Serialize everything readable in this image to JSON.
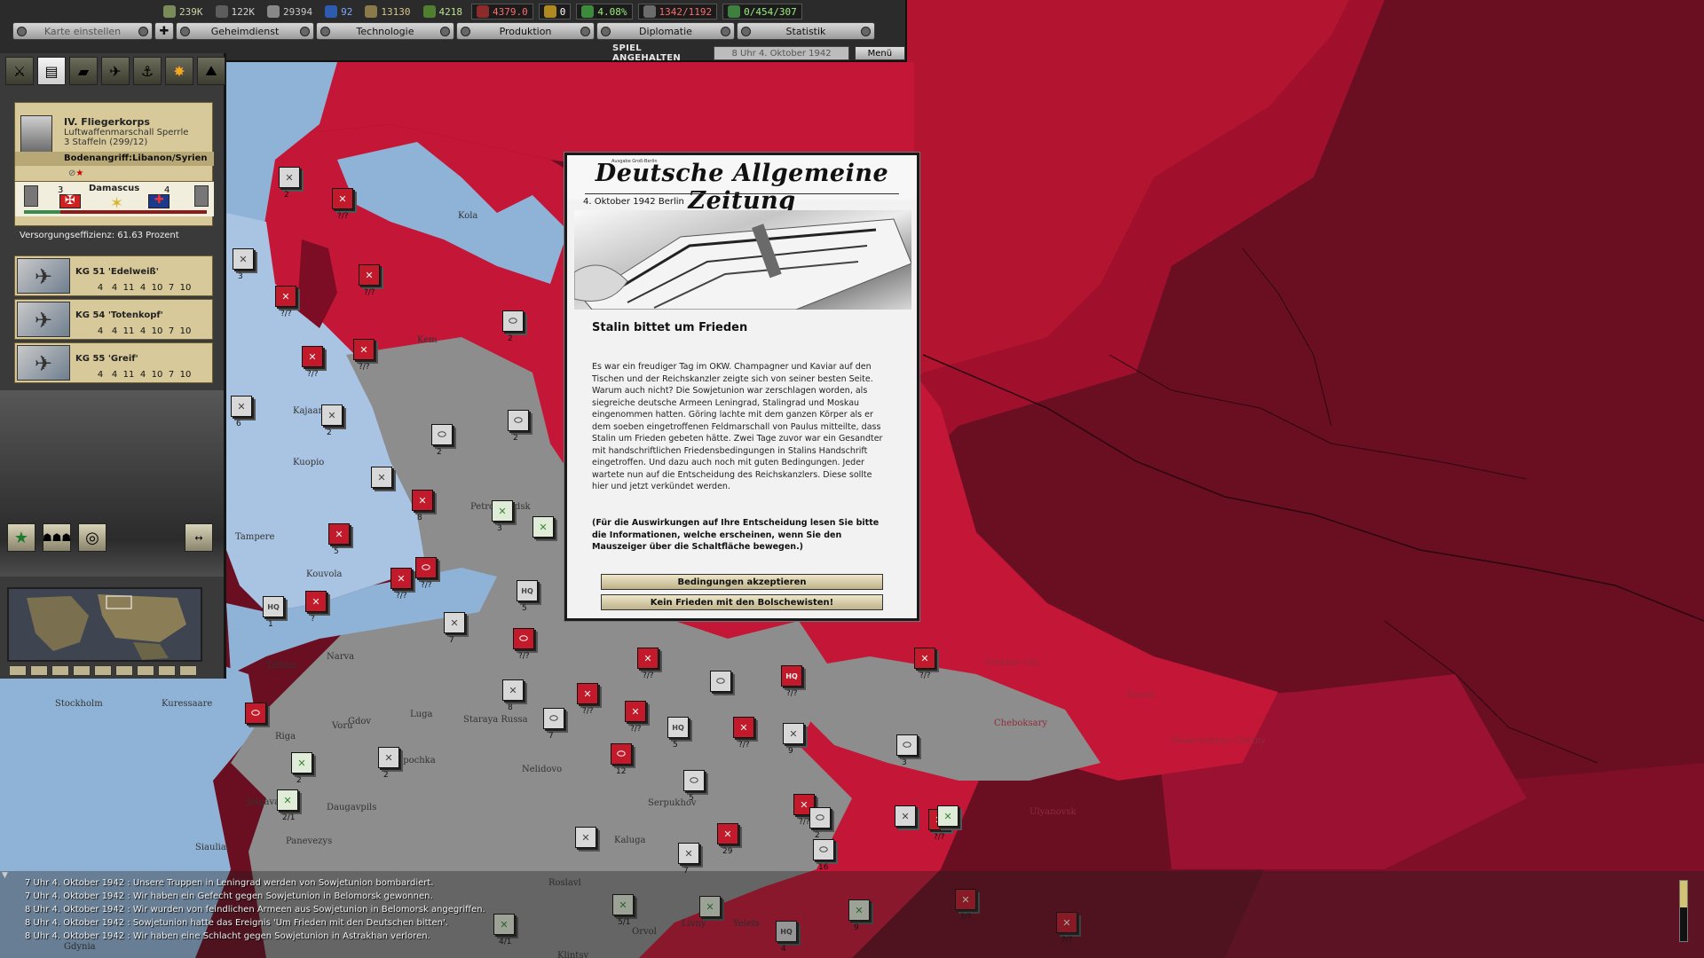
{
  "colors": {
    "sea": "#8fb3d6",
    "finland": "#a9c4e2",
    "soviet": "#c41636",
    "soviet_dark": "#9c0f2a",
    "soviet_deep": "#6a0f22",
    "axis_grey": "#8d8d8d",
    "panel": "#3a3a3a",
    "card": "#d7c99a"
  },
  "resources": [
    {
      "icon": "manpower-icon",
      "value": "239K",
      "color": "#c8d2a0"
    },
    {
      "icon": "energy-icon",
      "value": "122K",
      "color": "#d0d0d0"
    },
    {
      "icon": "metal-icon",
      "value": "29394",
      "color": "#c8c8c8"
    },
    {
      "icon": "oil-icon",
      "value": "92",
      "color": "#7fa7ff"
    },
    {
      "icon": "supplies-icon",
      "value": "13130",
      "color": "#d6c48a"
    },
    {
      "icon": "money-icon",
      "value": "4218",
      "color": "#b9e08c"
    },
    {
      "icon": "ic-icon",
      "value": "4379.0",
      "color": "#ff6a6a"
    },
    {
      "icon": "leadership-icon",
      "value": "0",
      "color": "#ffffff"
    },
    {
      "icon": "dissent-icon",
      "value": "4.08%",
      "color": "#9cf07a"
    },
    {
      "icon": "convoy-icon",
      "value": "1342/1192",
      "color": "#ff6a6a"
    },
    {
      "icon": "transport-icon",
      "value": "0/454/307",
      "color": "#9cf07a"
    }
  ],
  "menu": {
    "mapmode": "Karte einstellen",
    "buttons": [
      "Geheimdienst",
      "Technologie",
      "Produktion",
      "Diplomatie",
      "Statistik"
    ],
    "paused": "SPIEL ANGEHALTEN",
    "date": "8 Uhr 4. Oktober 1942",
    "menu_label": "Menü"
  },
  "corps": {
    "name": "IV. Fliegerkorps",
    "commander": "Luftwaffenmarschall Sperrle",
    "strength": "3 Staffeln (299/12)",
    "mission": "Bodenangriff:Libanon/Syrien",
    "battle_location": "Damascus",
    "attacker_count": "3",
    "defender_count": "4",
    "battle_progress": 0.2
  },
  "supply": "Versorgungseffizienz: 61.63 Prozent",
  "units": [
    {
      "name": "KG 51 'Edelweiß'",
      "stats": [
        "4",
        "4",
        "11",
        "4",
        "10",
        "7",
        "10"
      ]
    },
    {
      "name": "KG 54 'Totenkopf'",
      "stats": [
        "4",
        "4",
        "11",
        "4",
        "10",
        "7",
        "10"
      ]
    },
    {
      "name": "KG 55 'Greif'",
      "stats": [
        "4",
        "4",
        "11",
        "4",
        "10",
        "7",
        "10"
      ]
    }
  ],
  "newspaper": {
    "masthead": "Deutsche Allgemeine Zeitung",
    "masthead_small": "Ausgabe Groß-Berlin",
    "date": "4. Oktober 1942 Berlin",
    "headline": "Stalin bittet um Frieden",
    "body": "Es war ein freudiger Tag im OKW. Champagner und Kaviar auf den Tischen und der Reichskanzler zeigte sich von seiner besten Seite. Warum auch nicht? Die Sowjetunion war zerschlagen worden, als siegreiche deutsche Armeen Leningrad, Stalingrad und Moskau eingenommen hatten. Göring lachte mit dem ganzen Körper als er dem soeben eingetroffenen Feldmarschall von Paulus mitteilte, dass Stalin um Frieden gebeten hätte. Zwei Tage zuvor war ein Gesandter mit handschriftlichen Friedensbedingungen in Stalins Handschrift eingetroffen. Und dazu auch noch mit guten Bedingungen. Jeder wartete nun auf die Entscheidung des Reichskanzlers. Diese sollte hier und jetzt verkündet werden.",
    "note": "(Für die Auswirkungen auf Ihre Entscheidung lesen Sie bitte die Informationen, welche erscheinen, wenn Sie den Mauszeiger über die Schaltfläche bewegen.)",
    "accept": "Bedingungen akzeptieren",
    "reject": "Kein Frieden mit den Bolschewisten!"
  },
  "map_labels": [
    {
      "text": "Kola"
    },
    {
      "text": "Kem"
    },
    {
      "text": "Kuopio"
    },
    {
      "text": "Tampere"
    },
    {
      "text": "Kouvola"
    },
    {
      "text": "Narva"
    },
    {
      "text": "Tallinn"
    },
    {
      "text": "Gdov"
    },
    {
      "text": "Luga"
    },
    {
      "text": "Staraya Russa"
    },
    {
      "text": "Voru"
    },
    {
      "text": "Riga"
    },
    {
      "text": "Jelgava"
    },
    {
      "text": "Daugavpils"
    },
    {
      "text": "Opochka"
    },
    {
      "text": "Nelidovo"
    },
    {
      "text": "Kaluga"
    },
    {
      "text": "Serpukhov"
    },
    {
      "text": "Siauliai"
    },
    {
      "text": "Panevezys"
    },
    {
      "text": "Stockholm"
    },
    {
      "text": "Kuressaare"
    },
    {
      "text": "Kazan"
    },
    {
      "text": "Yoshkar Ola"
    },
    {
      "text": "Cheboksary"
    },
    {
      "text": "Naberezhnye Chelny"
    },
    {
      "text": "Ulyanovsk"
    },
    {
      "text": "Orvol"
    },
    {
      "text": "Livny"
    },
    {
      "text": "Yelets"
    },
    {
      "text": "Roslavl"
    },
    {
      "text": "Klintsy"
    },
    {
      "text": "Gdynia"
    },
    {
      "text": "Kajaani"
    },
    {
      "text": "Petrozavodsk"
    }
  ],
  "log": [
    "7 Uhr 4. Oktober 1942 : Unsere Truppen in Leningrad werden von Sowjetunion bombardiert.",
    "7 Uhr 4. Oktober 1942 : Wir haben ein Gefecht gegen Sowjetunion in Belomorsk gewonnen.",
    "8 Uhr 4. Oktober 1942 : Wir wurden von feindlichen Armeen aus Sowjetunion in Belomorsk angegriffen.",
    "8 Uhr 4. Oktober 1942 : Sowjetunion hatte das Ereignis 'Um Frieden mit den Deutschen bitten'.",
    "8 Uhr 4. Oktober 1942 : Wir haben eine Schlacht gegen Sowjetunion in Astrakhan verloren."
  ],
  "counters": [
    {
      "label": "2",
      "type": "inf",
      "side": "ger"
    },
    {
      "label": "?/?",
      "type": "inf",
      "side": "sov"
    },
    {
      "label": "3",
      "type": "inf",
      "side": "ger"
    },
    {
      "label": "?/?",
      "type": "inf",
      "side": "sov"
    },
    {
      "label": "2",
      "type": "arm",
      "side": "ger"
    },
    {
      "label": "?/?",
      "type": "inf",
      "side": "sov"
    },
    {
      "label": "?/?",
      "type": "inf",
      "side": "sov"
    },
    {
      "label": "?/?",
      "type": "inf",
      "side": "sov"
    },
    {
      "label": "6",
      "type": "inf",
      "side": "ger"
    },
    {
      "label": "2",
      "type": "inf",
      "side": "ger"
    },
    {
      "label": "2",
      "type": "arm",
      "side": "ger"
    },
    {
      "label": "2",
      "type": "arm",
      "side": "ger"
    },
    {
      "label": "",
      "type": "inf",
      "side": "ger"
    },
    {
      "label": "8",
      "type": "inf",
      "side": "sov"
    },
    {
      "label": "3",
      "type": "inf",
      "side": "ally"
    },
    {
      "label": "5",
      "type": "inf",
      "side": "sov"
    },
    {
      "label": "",
      "type": "inf",
      "side": "ally"
    },
    {
      "label": "?/?",
      "type": "arm",
      "side": "sov"
    },
    {
      "label": "?/?",
      "type": "inf",
      "side": "sov"
    },
    {
      "label": "?",
      "type": "inf",
      "side": "sov"
    },
    {
      "label": "7",
      "type": "inf",
      "side": "ger"
    },
    {
      "label": "5",
      "type": "hq",
      "side": "ger"
    },
    {
      "label": "1",
      "type": "hq",
      "side": "ger"
    },
    {
      "label": "?/?",
      "type": "arm",
      "side": "sov"
    },
    {
      "label": "?/?",
      "type": "inf",
      "side": "sov"
    },
    {
      "label": "?/?",
      "type": "inf",
      "side": "sov"
    },
    {
      "label": "?/?",
      "type": "inf",
      "side": "sov"
    },
    {
      "label": "",
      "type": "arm",
      "side": "ger"
    },
    {
      "label": "8",
      "type": "inf",
      "side": "ger"
    },
    {
      "label": "7",
      "type": "arm",
      "side": "ger"
    },
    {
      "label": "?/?",
      "type": "inf",
      "side": "sov"
    },
    {
      "label": "5",
      "type": "hq",
      "side": "ger"
    },
    {
      "label": "?/?",
      "type": "inf",
      "side": "sov"
    },
    {
      "label": "12",
      "type": "arm",
      "side": "sov"
    },
    {
      "label": "5",
      "type": "arm",
      "side": "ger"
    },
    {
      "label": "",
      "type": "inf",
      "side": "ger"
    },
    {
      "label": "9",
      "type": "inf",
      "side": "ger"
    },
    {
      "label": "?/?",
      "type": "inf",
      "side": "sov"
    },
    {
      "label": "?/?",
      "type": "hq",
      "side": "sov"
    },
    {
      "label": "3",
      "type": "arm",
      "side": "ger"
    },
    {
      "label": "2",
      "type": "arm",
      "side": "ger"
    },
    {
      "label": "?/?",
      "type": "inf",
      "side": "sov"
    },
    {
      "label": "16",
      "type": "arm",
      "side": "ger"
    },
    {
      "label": "29",
      "type": "inf",
      "side": "sov"
    },
    {
      "label": "",
      "type": "inf",
      "side": "ger"
    },
    {
      "label": "7",
      "type": "inf",
      "side": "ger"
    },
    {
      "label": "",
      "type": "arm",
      "side": "sov"
    },
    {
      "label": "2",
      "type": "inf",
      "side": "ally"
    },
    {
      "label": "2",
      "type": "inf",
      "side": "ger"
    },
    {
      "label": "2/1",
      "type": "inf",
      "side": "ally"
    },
    {
      "label": "",
      "type": "inf",
      "side": "ally"
    },
    {
      "label": "?/?",
      "type": "inf",
      "side": "sov"
    },
    {
      "label": "?/?",
      "type": "inf",
      "side": "sov"
    },
    {
      "label": "5/1",
      "type": "inf",
      "side": "ally"
    },
    {
      "label": "",
      "type": "inf",
      "side": "ally"
    },
    {
      "label": "4/1",
      "type": "inf",
      "side": "ally"
    },
    {
      "label": "4",
      "type": "hq",
      "side": "ger"
    },
    {
      "label": "9",
      "type": "inf",
      "side": "ally"
    }
  ]
}
